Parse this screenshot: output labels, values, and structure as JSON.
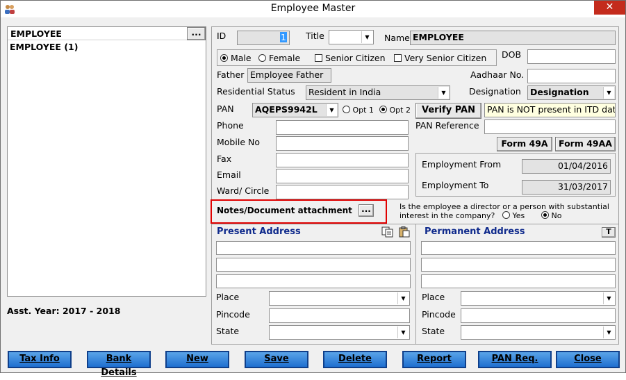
{
  "window": {
    "title": "Employee Master",
    "close_glyph": "✕"
  },
  "list": {
    "header": "EMPLOYEE",
    "browse": "...",
    "items": [
      "EMPLOYEE (1)"
    ]
  },
  "asst_year": "Asst. Year: 2017 - 2018",
  "form": {
    "id_label": "ID",
    "id_value": "1",
    "title_label": "Title",
    "title_value": "",
    "name_label": "Name",
    "name_value": "EMPLOYEE",
    "gender": {
      "male": "Male",
      "female": "Female",
      "selected": "Male"
    },
    "senior": "Senior Citizen",
    "very_senior": "Very Senior Citizen",
    "dob_label": "DOB",
    "dob_value": "",
    "father_label": "Father",
    "father_value": "Employee Father",
    "aadhaar_label": "Aadhaar No.",
    "aadhaar_value": "",
    "res_label": "Residential Status",
    "res_value": "Resident in India",
    "desig_label": "Designation",
    "desig_value": "Designation",
    "pan_label": "PAN",
    "pan_value": "AQEPS9942L",
    "opt1": "Opt 1",
    "opt2": "Opt 2",
    "opt_selected": "Opt 2",
    "verify_pan": "Verify PAN",
    "pan_status": "PAN is NOT present in ITD dat",
    "pan_ref_label": "PAN Reference",
    "pan_ref_value": "",
    "phone_label": "Phone",
    "mobile_label": "Mobile No",
    "fax_label": "Fax",
    "email_label": "Email",
    "ward_label": "Ward/ Circle",
    "form49a": "Form 49A",
    "form49aa": "Form 49AA",
    "emp_from_label": "Employment From",
    "emp_from": "01/04/2016",
    "emp_to_label": "Employment To",
    "emp_to": "31/03/2017",
    "notes_label": "Notes/Document attachment",
    "notes_btn": "...",
    "director_q1": "Is the employee a director or a person with substantial",
    "director_q2": "interest in the company?",
    "yes": "Yes",
    "no": "No",
    "director_selected": "No",
    "present_addr": "Present Address",
    "perm_addr": "Permanent Address",
    "t_btn": "T",
    "place": "Place",
    "pincode": "Pincode",
    "state": "State"
  },
  "buttons": [
    "Tax Info",
    "Bank Details",
    "New",
    "Save",
    "Delete",
    "Report",
    "PAN Req.",
    "Close"
  ],
  "colors": {
    "highlight_border": "#e00000",
    "header_blue": "#0f2a8c",
    "button_blue": "#2a7ad8"
  }
}
